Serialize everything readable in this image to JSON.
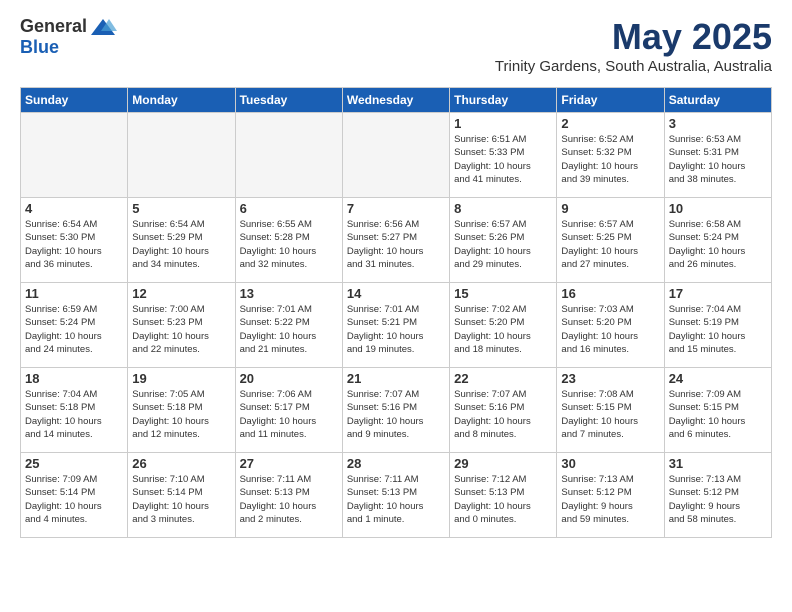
{
  "header": {
    "logo_general": "General",
    "logo_blue": "Blue",
    "month_title": "May 2025",
    "subtitle": "Trinity Gardens, South Australia, Australia"
  },
  "days_of_week": [
    "Sunday",
    "Monday",
    "Tuesday",
    "Wednesday",
    "Thursday",
    "Friday",
    "Saturday"
  ],
  "weeks": [
    [
      {
        "day": "",
        "info": "",
        "empty": true
      },
      {
        "day": "",
        "info": "",
        "empty": true
      },
      {
        "day": "",
        "info": "",
        "empty": true
      },
      {
        "day": "",
        "info": "",
        "empty": true
      },
      {
        "day": "1",
        "info": "Sunrise: 6:51 AM\nSunset: 5:33 PM\nDaylight: 10 hours\nand 41 minutes."
      },
      {
        "day": "2",
        "info": "Sunrise: 6:52 AM\nSunset: 5:32 PM\nDaylight: 10 hours\nand 39 minutes."
      },
      {
        "day": "3",
        "info": "Sunrise: 6:53 AM\nSunset: 5:31 PM\nDaylight: 10 hours\nand 38 minutes."
      }
    ],
    [
      {
        "day": "4",
        "info": "Sunrise: 6:54 AM\nSunset: 5:30 PM\nDaylight: 10 hours\nand 36 minutes."
      },
      {
        "day": "5",
        "info": "Sunrise: 6:54 AM\nSunset: 5:29 PM\nDaylight: 10 hours\nand 34 minutes."
      },
      {
        "day": "6",
        "info": "Sunrise: 6:55 AM\nSunset: 5:28 PM\nDaylight: 10 hours\nand 32 minutes."
      },
      {
        "day": "7",
        "info": "Sunrise: 6:56 AM\nSunset: 5:27 PM\nDaylight: 10 hours\nand 31 minutes."
      },
      {
        "day": "8",
        "info": "Sunrise: 6:57 AM\nSunset: 5:26 PM\nDaylight: 10 hours\nand 29 minutes."
      },
      {
        "day": "9",
        "info": "Sunrise: 6:57 AM\nSunset: 5:25 PM\nDaylight: 10 hours\nand 27 minutes."
      },
      {
        "day": "10",
        "info": "Sunrise: 6:58 AM\nSunset: 5:24 PM\nDaylight: 10 hours\nand 26 minutes."
      }
    ],
    [
      {
        "day": "11",
        "info": "Sunrise: 6:59 AM\nSunset: 5:24 PM\nDaylight: 10 hours\nand 24 minutes."
      },
      {
        "day": "12",
        "info": "Sunrise: 7:00 AM\nSunset: 5:23 PM\nDaylight: 10 hours\nand 22 minutes."
      },
      {
        "day": "13",
        "info": "Sunrise: 7:01 AM\nSunset: 5:22 PM\nDaylight: 10 hours\nand 21 minutes."
      },
      {
        "day": "14",
        "info": "Sunrise: 7:01 AM\nSunset: 5:21 PM\nDaylight: 10 hours\nand 19 minutes."
      },
      {
        "day": "15",
        "info": "Sunrise: 7:02 AM\nSunset: 5:20 PM\nDaylight: 10 hours\nand 18 minutes."
      },
      {
        "day": "16",
        "info": "Sunrise: 7:03 AM\nSunset: 5:20 PM\nDaylight: 10 hours\nand 16 minutes."
      },
      {
        "day": "17",
        "info": "Sunrise: 7:04 AM\nSunset: 5:19 PM\nDaylight: 10 hours\nand 15 minutes."
      }
    ],
    [
      {
        "day": "18",
        "info": "Sunrise: 7:04 AM\nSunset: 5:18 PM\nDaylight: 10 hours\nand 14 minutes."
      },
      {
        "day": "19",
        "info": "Sunrise: 7:05 AM\nSunset: 5:18 PM\nDaylight: 10 hours\nand 12 minutes."
      },
      {
        "day": "20",
        "info": "Sunrise: 7:06 AM\nSunset: 5:17 PM\nDaylight: 10 hours\nand 11 minutes."
      },
      {
        "day": "21",
        "info": "Sunrise: 7:07 AM\nSunset: 5:16 PM\nDaylight: 10 hours\nand 9 minutes."
      },
      {
        "day": "22",
        "info": "Sunrise: 7:07 AM\nSunset: 5:16 PM\nDaylight: 10 hours\nand 8 minutes."
      },
      {
        "day": "23",
        "info": "Sunrise: 7:08 AM\nSunset: 5:15 PM\nDaylight: 10 hours\nand 7 minutes."
      },
      {
        "day": "24",
        "info": "Sunrise: 7:09 AM\nSunset: 5:15 PM\nDaylight: 10 hours\nand 6 minutes."
      }
    ],
    [
      {
        "day": "25",
        "info": "Sunrise: 7:09 AM\nSunset: 5:14 PM\nDaylight: 10 hours\nand 4 minutes."
      },
      {
        "day": "26",
        "info": "Sunrise: 7:10 AM\nSunset: 5:14 PM\nDaylight: 10 hours\nand 3 minutes."
      },
      {
        "day": "27",
        "info": "Sunrise: 7:11 AM\nSunset: 5:13 PM\nDaylight: 10 hours\nand 2 minutes."
      },
      {
        "day": "28",
        "info": "Sunrise: 7:11 AM\nSunset: 5:13 PM\nDaylight: 10 hours\nand 1 minute."
      },
      {
        "day": "29",
        "info": "Sunrise: 7:12 AM\nSunset: 5:13 PM\nDaylight: 10 hours\nand 0 minutes."
      },
      {
        "day": "30",
        "info": "Sunrise: 7:13 AM\nSunset: 5:12 PM\nDaylight: 9 hours\nand 59 minutes."
      },
      {
        "day": "31",
        "info": "Sunrise: 7:13 AM\nSunset: 5:12 PM\nDaylight: 9 hours\nand 58 minutes."
      }
    ]
  ]
}
